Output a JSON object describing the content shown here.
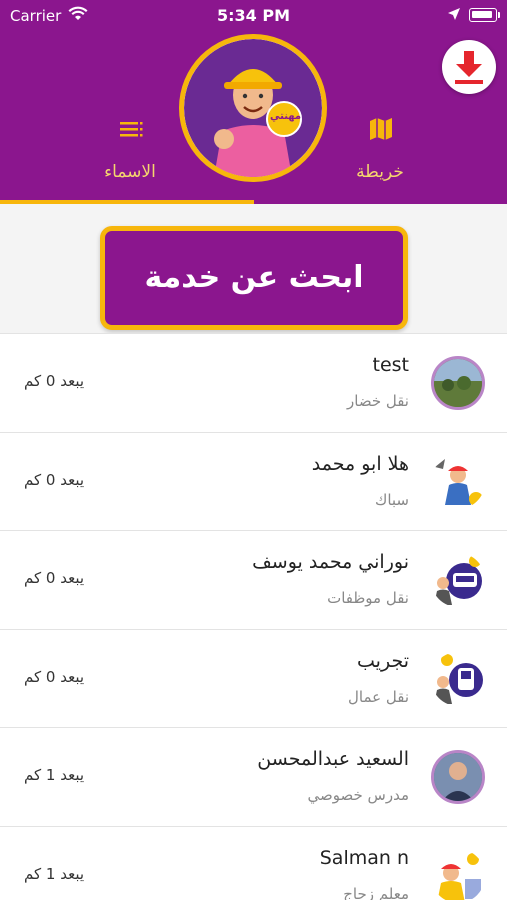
{
  "status_bar": {
    "carrier": "Carrier",
    "time": "5:34 PM"
  },
  "header": {
    "tabs": [
      {
        "label": "الاسماء",
        "icon": "list-icon",
        "active": true
      },
      {
        "label": "خريطة",
        "icon": "map-icon",
        "active": false
      }
    ],
    "logo_text": "مهنتي",
    "download_icon": "download-icon",
    "colors": {
      "primary": "#8b168e",
      "accent": "#f7b60c",
      "tab_text": "#f5d76e"
    }
  },
  "search_button": {
    "label": "ابحث عن خدمة"
  },
  "providers": [
    {
      "name": "test",
      "service": "نقل خضار",
      "distance": "يبعد 0 كم",
      "avatar": "photo"
    },
    {
      "name": "هلا ابو محمد",
      "service": "سباك",
      "distance": "يبعد 0 كم",
      "avatar": "plumber-icon"
    },
    {
      "name": "نوراني محمد يوسف",
      "service": "نقل موظفات",
      "distance": "يبعد 0 كم",
      "avatar": "bus-driver-icon"
    },
    {
      "name": "تجريب",
      "service": "نقل عمال",
      "distance": "يبعد 0 كم",
      "avatar": "bus-driver-icon"
    },
    {
      "name": "السعيد عبدالمحسن",
      "service": "مدرس خصوصي",
      "distance": "يبعد 1 كم",
      "avatar": "person-photo"
    },
    {
      "name": "Salman n",
      "service": "معلم زجاج",
      "distance": "يبعد 1 كم",
      "avatar": "worker-icon"
    }
  ]
}
